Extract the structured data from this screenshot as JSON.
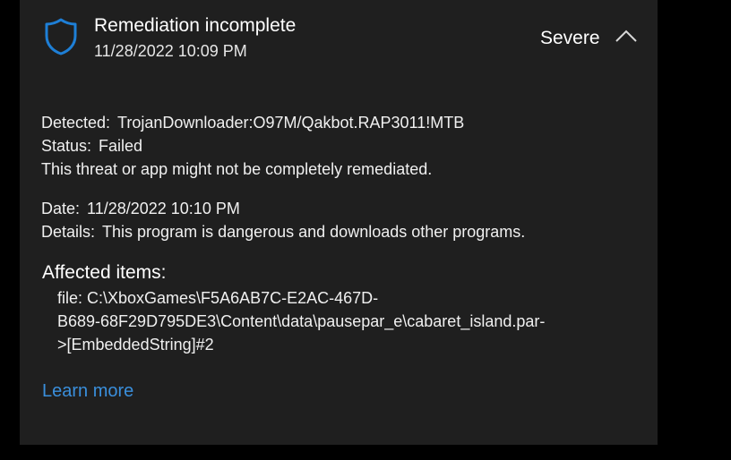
{
  "header": {
    "title": "Remediation incomplete",
    "timestamp": "11/28/2022 10:09 PM",
    "severity": "Severe",
    "shield_icon": "shield-icon",
    "collapse_icon": "chevron-up-icon"
  },
  "details": {
    "detected_label": "Detected:",
    "detected_value": "TrojanDownloader:O97M/Qakbot.RAP3011!MTB",
    "status_label": "Status:",
    "status_value": "Failed",
    "status_note": "This threat or app might not be completely remediated.",
    "date_label": "Date:",
    "date_value": "11/28/2022 10:10 PM",
    "details_label": "Details:",
    "details_value": "This program is dangerous and downloads other programs."
  },
  "affected": {
    "heading": "Affected items:",
    "path_lines": [
      "file: C:\\XboxGames\\F5A6AB7C-E2AC-467D-",
      "B689-68F29D795DE3\\Content\\data\\pausepar_e\\cabaret_island.par-",
      ">[EmbeddedString]#2"
    ]
  },
  "learn_more": "Learn more",
  "colors": {
    "background": "#000000",
    "panel": "#1f1f1f",
    "accent": "#3a8fdc",
    "shield": "#1e7fd6"
  }
}
